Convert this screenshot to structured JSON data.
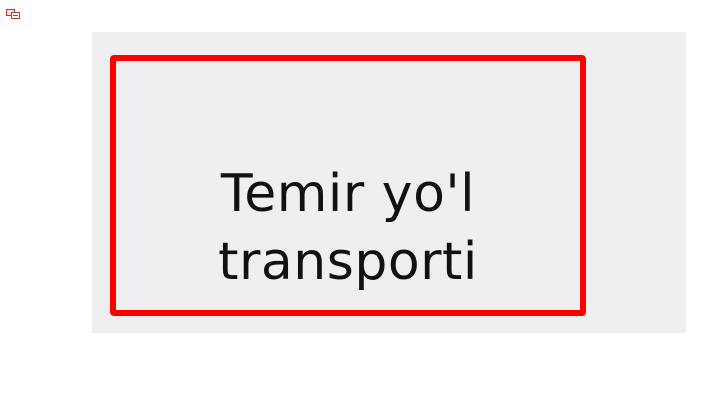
{
  "corner_icon": "translate-icon",
  "card": {
    "line1": "Temir yo'l",
    "line2": "transporti",
    "frame_color": "#ff0000",
    "background": "#efeff1"
  }
}
